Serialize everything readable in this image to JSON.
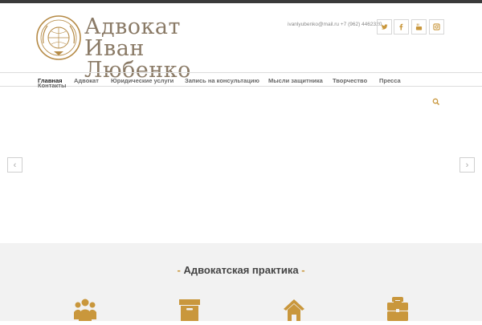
{
  "brand": {
    "line1": "Адвокат",
    "line2": "Иван Любенко"
  },
  "header": {
    "contact": "ivanlyubenko@mail.ru +7 (962) 4462320",
    "social": [
      "twitter-icon",
      "facebook-icon",
      "youtube-icon",
      "instagram-icon"
    ]
  },
  "nav": {
    "items": [
      {
        "label": "Главная",
        "active": true
      },
      {
        "label": "Адвокат"
      },
      {
        "label": "Юридические услуги"
      },
      {
        "label": "Запись на консультацию"
      },
      {
        "label": "Мысли защитника"
      },
      {
        "label": "Творчество"
      },
      {
        "label": "Пресса"
      },
      {
        "label": "Контакты"
      }
    ]
  },
  "slider": {
    "prev": "‹",
    "next": "›"
  },
  "practice": {
    "title": "Адвокатская практика",
    "dash": "-",
    "icons": [
      "group-icon",
      "archive-icon",
      "home-icon",
      "briefcase-icon"
    ]
  },
  "colors": {
    "accent": "#c9973c",
    "dark_bar": "#3a3a3a",
    "logo_text": "#8a7a66",
    "section_bg": "#f2f2f2"
  }
}
